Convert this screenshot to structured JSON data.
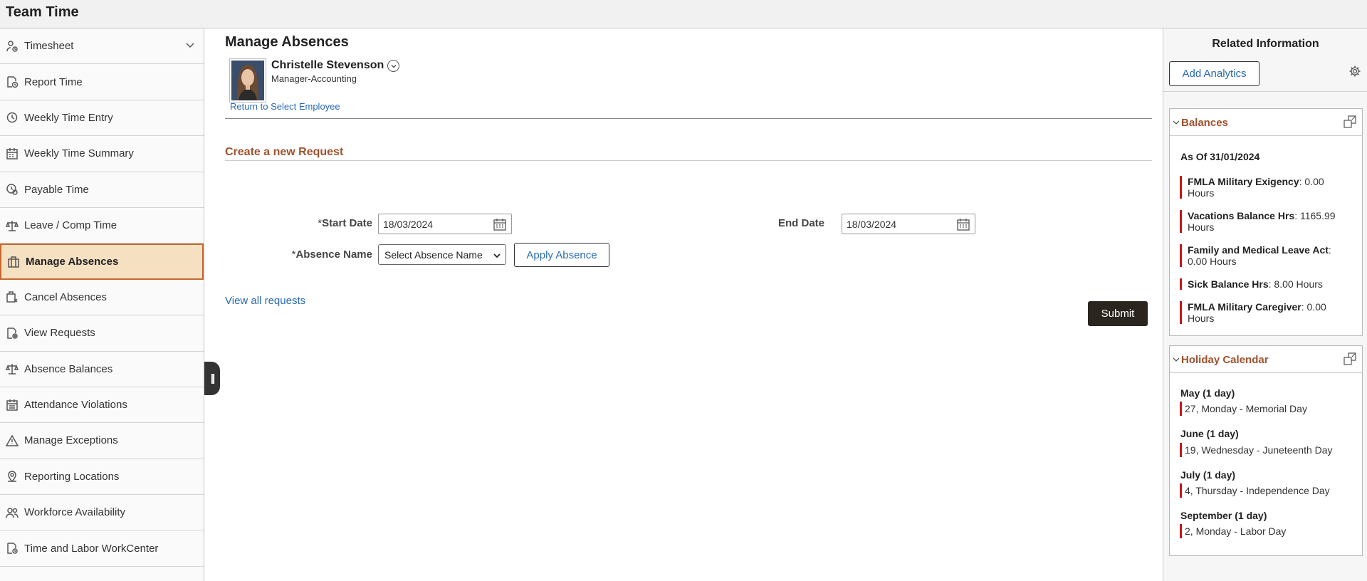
{
  "app": {
    "title": "Team Time"
  },
  "sidebar": {
    "items": [
      {
        "label": "Timesheet",
        "icon": "person-clock-icon",
        "has_submenu": true
      },
      {
        "label": "Report Time",
        "icon": "report-time-icon"
      },
      {
        "label": "Weekly Time Entry",
        "icon": "clock-entry-icon"
      },
      {
        "label": "Weekly Time Summary",
        "icon": "calendar-grid-icon"
      },
      {
        "label": "Payable Time",
        "icon": "payable-time-icon"
      },
      {
        "label": "Leave / Comp Time",
        "icon": "scale-icon"
      },
      {
        "label": "Manage Absences",
        "icon": "briefcase-icon",
        "active": true
      },
      {
        "label": "Cancel Absences",
        "icon": "briefcase-cancel-icon"
      },
      {
        "label": "View Requests",
        "icon": "document-view-icon"
      },
      {
        "label": "Absence Balances",
        "icon": "balance-scale-icon"
      },
      {
        "label": "Attendance Violations",
        "icon": "calendar-icon"
      },
      {
        "label": "Manage Exceptions",
        "icon": "warning-icon"
      },
      {
        "label": "Reporting Locations",
        "icon": "location-pin-icon"
      },
      {
        "label": "Workforce Availability",
        "icon": "people-icon"
      },
      {
        "label": "Time and Labor WorkCenter",
        "icon": "workcenter-icon"
      }
    ],
    "active_color": "#f6e0c2",
    "active_border": "#c5682d"
  },
  "main": {
    "page_title": "Manage Absences",
    "employee": {
      "name": "Christelle Stevenson",
      "title": "Manager-Accounting",
      "return_link": "Return to Select Employee"
    },
    "section_title": "Create a new Request",
    "form": {
      "start_date_label": "Start Date",
      "start_date_value": "18/03/2024",
      "end_date_label": "End Date",
      "end_date_value": "18/03/2024",
      "absence_name_label": "Absence Name",
      "absence_name_selected": "Select Absence Name",
      "required_marker": "*",
      "apply_button": "Apply Absence"
    },
    "view_all_link": "View all requests",
    "submit_button": "Submit"
  },
  "right_panel": {
    "title": "Related Information",
    "add_analytics_button": "Add Analytics",
    "balances": {
      "title": "Balances",
      "as_of": "As Of 31/01/2024",
      "items": [
        {
          "name": "FMLA Military Exigency",
          "value": ": 0.00",
          "unit": "Hours"
        },
        {
          "name": "Vacations Balance Hrs",
          "value": ": 1165.99",
          "unit": "Hours"
        },
        {
          "name": "Family and Medical Leave Act",
          "value": ":",
          "unit": "0.00 Hours"
        },
        {
          "name": "Sick Balance Hrs",
          "value": ": 8.00 Hours",
          "unit": ""
        },
        {
          "name": "FMLA Military Caregiver",
          "value": ": 0.00",
          "unit": "Hours"
        }
      ]
    },
    "holiday_calendar": {
      "title": "Holiday Calendar",
      "months": [
        {
          "month": "May (1 day)",
          "holiday": "27, Monday - Memorial Day"
        },
        {
          "month": "June (1 day)",
          "holiday": "19, Wednesday - Juneteenth Day"
        },
        {
          "month": "July (1 day)",
          "holiday": "4, Thursday - Independence Day"
        },
        {
          "month": "September (1 day)",
          "holiday": "2, Monday - Labor Day"
        }
      ]
    }
  },
  "colors": {
    "link": "#2a6ab3",
    "section_title": "#a0522d",
    "balance_bar": "#c4161c",
    "primary_button": "#2b2520"
  }
}
